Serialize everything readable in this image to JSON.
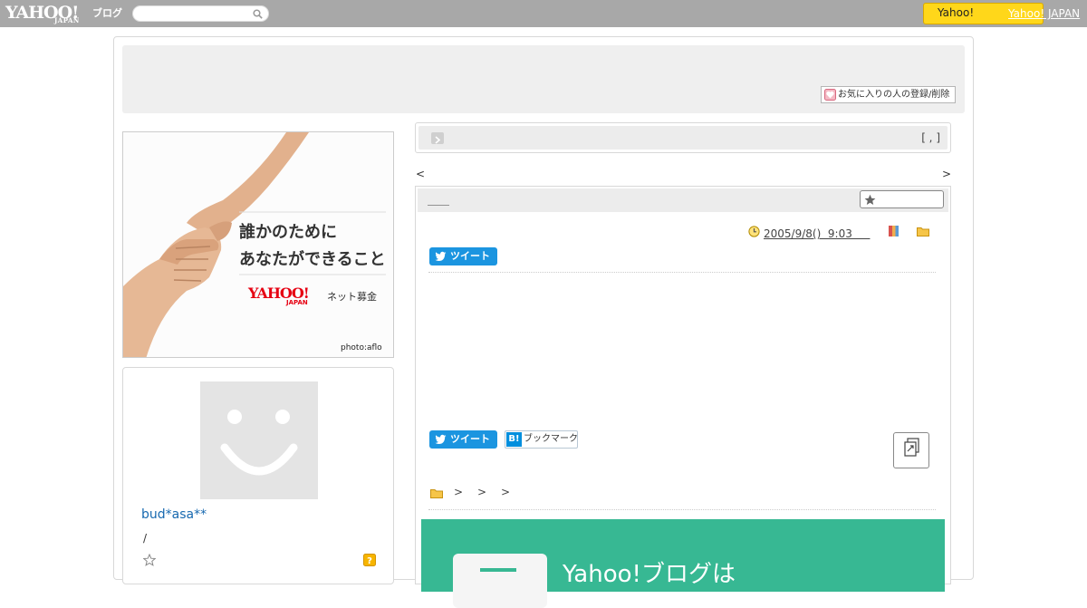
{
  "topbar": {
    "logo_text": "YAHOO!",
    "logo_sub": "JAPAN",
    "logo_service": "ブログ",
    "search_placeholder": "",
    "yahoo_button_label": "Yahoo!",
    "yahoo_japan_link": "Yahoo! JAPAN"
  },
  "header": {
    "favorite_register_label": "お気に入りの人の登録/削除"
  },
  "ad": {
    "line1": "誰かのために",
    "line2": "あなたができること",
    "logo": "YAHOO!",
    "logo_sub": "JAPAN",
    "tagline": "ネット募金",
    "credit": "photo:aflo"
  },
  "profile": {
    "name": "bud*asa**",
    "separator": "/"
  },
  "breadcrumb": {
    "right_text": "[ , ]"
  },
  "pager": {
    "prev": "<",
    "next": ">"
  },
  "article": {
    "title": "＿＿",
    "date": "2005/9/8()  9:03 　 ",
    "tweet_label": "ツイート",
    "hatena_mark": "B!",
    "hatena_label": "ブックマーク",
    "category_separators": [
      ">",
      ">",
      ">"
    ]
  },
  "banner": {
    "text": "Yahoo!ブログは"
  },
  "colors": {
    "topbar": "#a8a8a8",
    "yahoo_button": "#ffd71a",
    "twitter": "#1b95e0",
    "hatena": "#008fde",
    "banner": "#37b893",
    "link": "#1769b0"
  }
}
